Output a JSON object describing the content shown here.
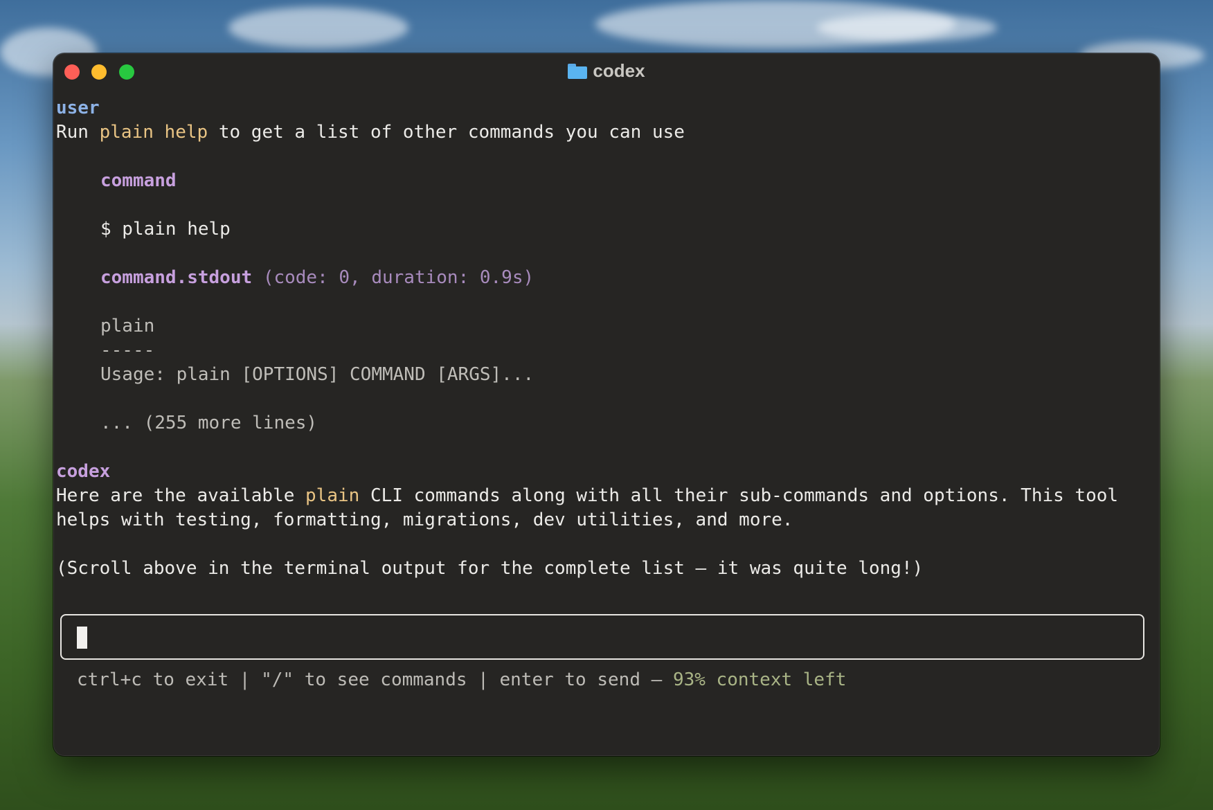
{
  "window": {
    "title": "codex",
    "title_icon": "folder-icon"
  },
  "transcript": {
    "user_label": "user",
    "user_message": {
      "pre": "Run ",
      "highlight": "plain help",
      "post": " to get a list of other commands you can use"
    },
    "command_label": "command",
    "command_line": "$ plain help",
    "stdout_label": "command.stdout",
    "stdout_meta": "(code: 0, duration: 0.9s)",
    "stdout_lines": [
      "plain",
      "-----",
      "Usage: plain [OPTIONS] COMMAND [ARGS]..."
    ],
    "more_lines": "... (255 more lines)",
    "codex_label": "codex",
    "codex_reply_1": {
      "pre": "Here are the available ",
      "highlight": "plain",
      "post": " CLI commands along with all their sub-commands and options. This tool"
    },
    "codex_reply_2": "helps with testing, formatting, migrations, dev utilities, and more.",
    "codex_reply_3": "(Scroll above in the terminal output for the complete list – it was quite long!)"
  },
  "input": {
    "value": ""
  },
  "footer": {
    "hints": "ctrl+c to exit | \"/\" to see commands | enter to send — ",
    "context": "93% context left"
  },
  "colors": {
    "terminal_bg": "#262523",
    "user_label": "#8db2e6",
    "accent_purple": "#c7a0de",
    "highlight_yellow": "#e9c484",
    "context_green": "#a9b486"
  }
}
